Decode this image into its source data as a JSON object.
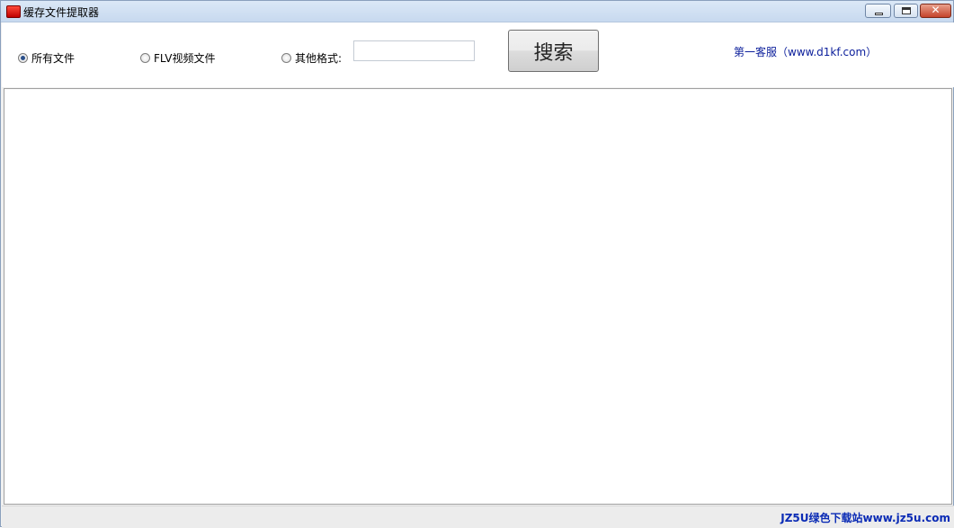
{
  "window": {
    "title": "缓存文件提取器",
    "controls": {
      "minimize": "minimize",
      "maximize": "maximize",
      "close": "✕"
    }
  },
  "toolbar": {
    "radios": [
      {
        "label": "所有文件",
        "checked": true
      },
      {
        "label": "FLV视频文件",
        "checked": false
      },
      {
        "label": "其他格式:",
        "checked": false
      }
    ],
    "format_input_value": "",
    "search_label": "搜索",
    "link_text": "第一客服（www.d1kf.com）"
  },
  "status": {
    "watermark": "JZ5U绿色下载站www.jz5u.com"
  },
  "colors": {
    "link": "#0b1e9b",
    "watermark": "#0a2bb5",
    "titlebar": "#c7d9ef"
  }
}
